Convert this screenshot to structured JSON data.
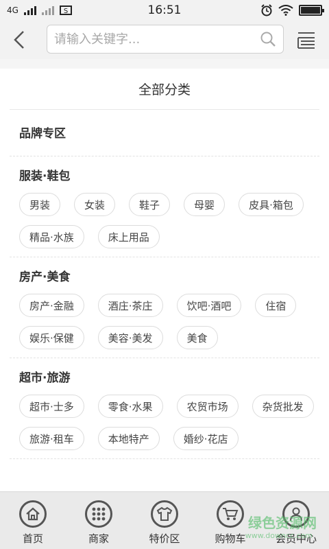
{
  "statusbar": {
    "network": "4G",
    "time": "16:51"
  },
  "search": {
    "placeholder": "请输入关键字..."
  },
  "page": {
    "title": "全部分类"
  },
  "sections": [
    {
      "title": "品牌专区",
      "tags": []
    },
    {
      "title": "服装·鞋包",
      "tags": [
        "男装",
        "女装",
        "鞋子",
        "母婴",
        "皮具·箱包",
        "精品·水族",
        "床上用品"
      ]
    },
    {
      "title": "房产·美食",
      "tags": [
        "房产·金融",
        "酒庄·茶庄",
        "饮吧·酒吧",
        "住宿",
        "娱乐·保健",
        "美容·美发",
        "美食"
      ]
    },
    {
      "title": "超市·旅游",
      "tags": [
        "超市·士多",
        "零食·水果",
        "农贸市场",
        "杂货批发",
        "旅游·租车",
        "本地特产",
        "婚纱·花店"
      ]
    }
  ],
  "tabbar": {
    "items": [
      {
        "label": "首页",
        "icon": "home-icon"
      },
      {
        "label": "商家",
        "icon": "grid-icon"
      },
      {
        "label": "特价区",
        "icon": "shirt-icon"
      },
      {
        "label": "购物车",
        "icon": "cart-icon"
      },
      {
        "label": "会员中心",
        "icon": "user-icon"
      }
    ]
  },
  "watermark": {
    "text": "绿色资源网",
    "url": "www.downcc.com"
  },
  "colors": {
    "header_bg": "#f2f2f2",
    "tabbar_bg": "#eaeaea",
    "watermark": "#5abe6e"
  }
}
